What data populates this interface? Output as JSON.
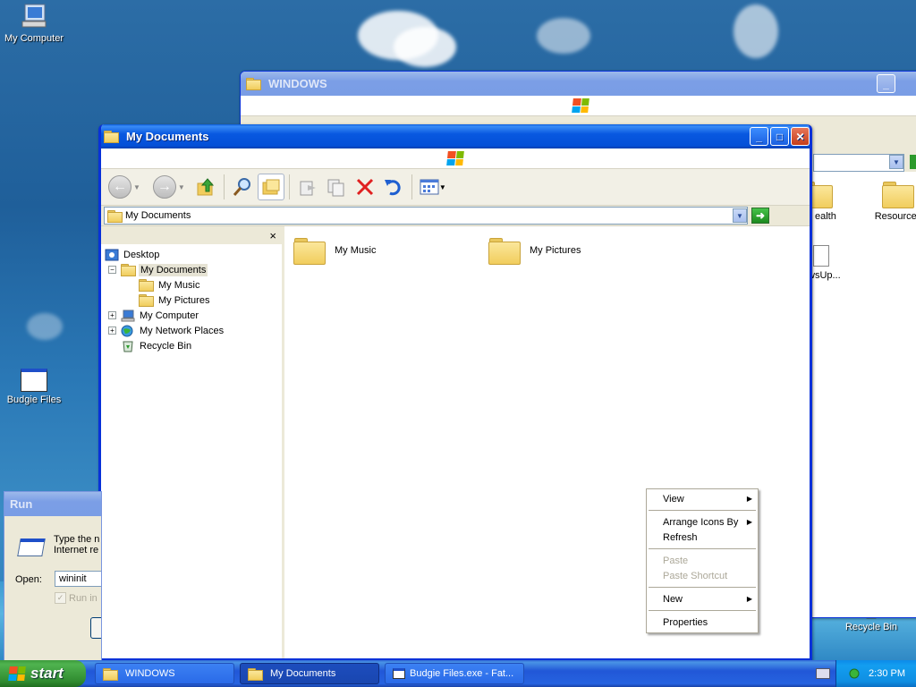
{
  "desktop": {
    "icons": [
      {
        "label": "My Computer"
      },
      {
        "label": "Budgie Files"
      },
      {
        "label": "Recycle Bin"
      }
    ]
  },
  "bg_window": {
    "title": "WINDOWS",
    "items": [
      "ealth",
      "Resources",
      "wsUp..."
    ]
  },
  "explorer": {
    "title": "My Documents",
    "address": "My Documents",
    "close_pane": "×",
    "tree": [
      {
        "label": "Desktop",
        "expander": ""
      },
      {
        "label": "My Documents",
        "expander": "−"
      },
      {
        "label": "My Music",
        "expander": ""
      },
      {
        "label": "My Pictures",
        "expander": ""
      },
      {
        "label": "My Computer",
        "expander": "+"
      },
      {
        "label": "My Network Places",
        "expander": "+"
      },
      {
        "label": "Recycle Bin",
        "expander": ""
      }
    ],
    "content_items": [
      "My Music",
      "My Pictures"
    ]
  },
  "context_menu": {
    "view": "View",
    "arrange": "Arrange Icons By",
    "refresh": "Refresh",
    "paste": "Paste",
    "paste_shortcut": "Paste Shortcut",
    "new": "New",
    "properties": "Properties",
    "submenu_arrow": "▶"
  },
  "run": {
    "title": "Run",
    "desc_line1": "Type the n",
    "desc_line2": "Internet re",
    "open_label": "Open:",
    "open_value": "wininit",
    "run_in": "Run in"
  },
  "taskbar": {
    "start": "start",
    "tasks": [
      "WINDOWS",
      "My Documents",
      "Budgie Files.exe - Fat..."
    ],
    "clock": "2:30 PM"
  },
  "colors": {
    "xp_blue": "#0450d8",
    "start_green": "#2f8a2f",
    "tray_blue": "#0f8ee2",
    "delete_red": "#e02020"
  }
}
